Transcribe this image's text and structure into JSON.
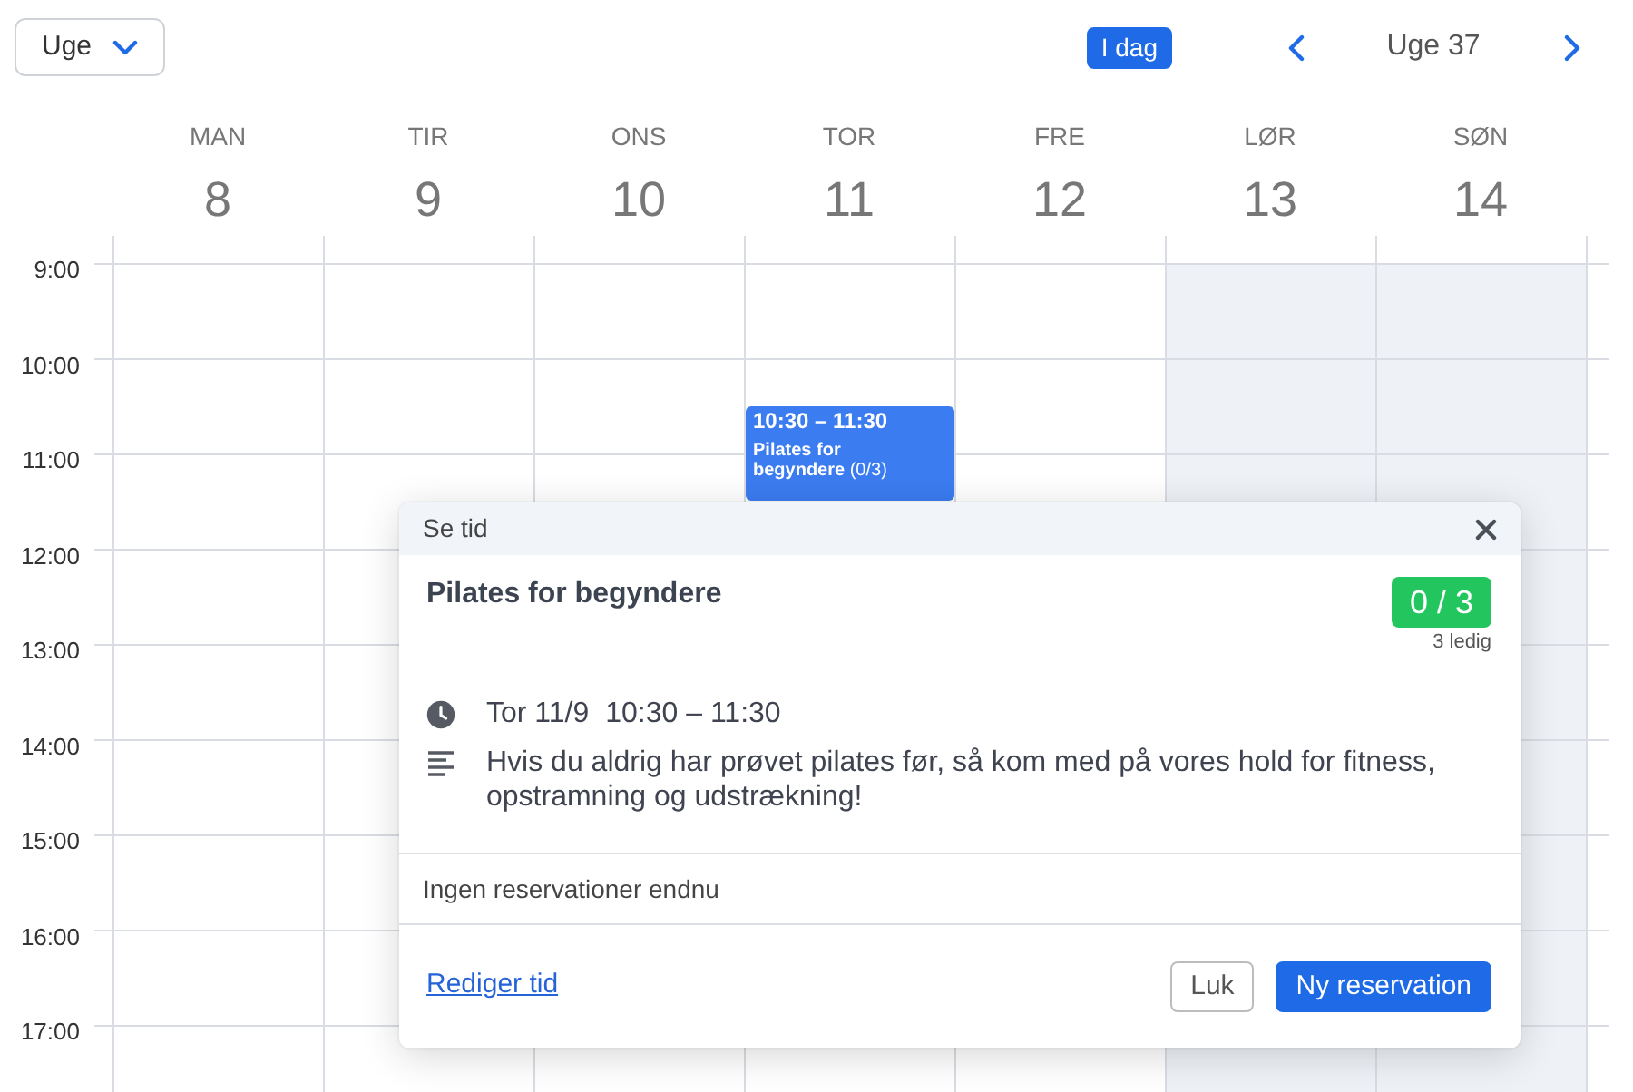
{
  "toolbar": {
    "view_select": {
      "value": "Uge"
    },
    "today_button": "I dag",
    "period_label": "Uge 37"
  },
  "days": [
    {
      "name": "MAN",
      "number": "8",
      "weekend": false
    },
    {
      "name": "TIR",
      "number": "9",
      "weekend": false
    },
    {
      "name": "ONS",
      "number": "10",
      "weekend": false
    },
    {
      "name": "TOR",
      "number": "11",
      "weekend": false,
      "events": [
        {
          "time": "10:30 – 11:30",
          "title": "**Pilates for begyndere** (0/3)"
        }
      ]
    },
    {
      "name": "FRE",
      "number": "12",
      "weekend": false
    },
    {
      "name": "LØR",
      "number": "13",
      "weekend": true
    },
    {
      "name": "SØN",
      "number": "14",
      "weekend": true
    }
  ],
  "hours": [
    "9:00",
    "10:00",
    "11:00",
    "12:00",
    "13:00",
    "14:00",
    "15:00",
    "16:00",
    "17:00"
  ],
  "popup": {
    "header": "Se tid",
    "title": "Pilates for begyndere",
    "capacity": "0 / 3",
    "availability": "3 ledig",
    "date": "Tor 11/9",
    "time": "10:30 – 11:30",
    "description": "Hvis du aldrig har prøvet pilates før, så kom med på vores hold for fitness, opstramning og udstrækning!",
    "reservations": "Ingen reservationer endnu",
    "edit_link": "Rediger tid",
    "buttons": [
      {
        "label": "Luk",
        "kind": "secondary"
      },
      {
        "label": "Ny reservation",
        "kind": "primary"
      }
    ]
  }
}
